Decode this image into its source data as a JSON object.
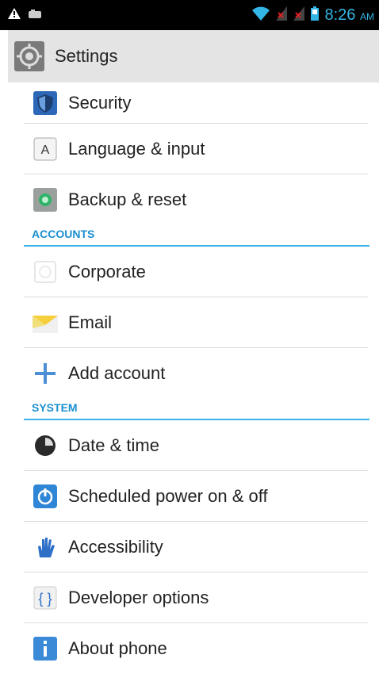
{
  "status_bar": {
    "time": "8:26",
    "ampm": "AM",
    "icons": [
      "warning-icon",
      "notification-icon",
      "wifi-icon",
      "signal-1-off-icon",
      "signal-2-off-icon",
      "battery-icon"
    ]
  },
  "action_bar": {
    "title": "Settings",
    "icon": "settings-gear-icon"
  },
  "items_top": [
    {
      "label": "Security",
      "icon": "security-shield-icon"
    },
    {
      "label": "Language & input",
      "icon": "language-a-icon"
    },
    {
      "label": "Backup & reset",
      "icon": "backup-reset-icon"
    }
  ],
  "section_accounts": "ACCOUNTS",
  "items_accounts": [
    {
      "label": "Corporate",
      "icon": "corporate-icon"
    },
    {
      "label": "Email",
      "icon": "email-envelope-icon"
    },
    {
      "label": "Add account",
      "icon": "add-plus-icon"
    }
  ],
  "section_system": "SYSTEM",
  "items_system": [
    {
      "label": "Date & time",
      "icon": "clock-icon"
    },
    {
      "label": "Scheduled power on & off",
      "icon": "power-schedule-icon"
    },
    {
      "label": "Accessibility",
      "icon": "accessibility-hand-icon"
    },
    {
      "label": "Developer options",
      "icon": "developer-braces-icon"
    },
    {
      "label": "About phone",
      "icon": "info-icon"
    }
  ],
  "colors": {
    "accent": "#33b5e5",
    "section_text": "#1a8fd0",
    "action_bar_bg": "#e4e4e4"
  }
}
